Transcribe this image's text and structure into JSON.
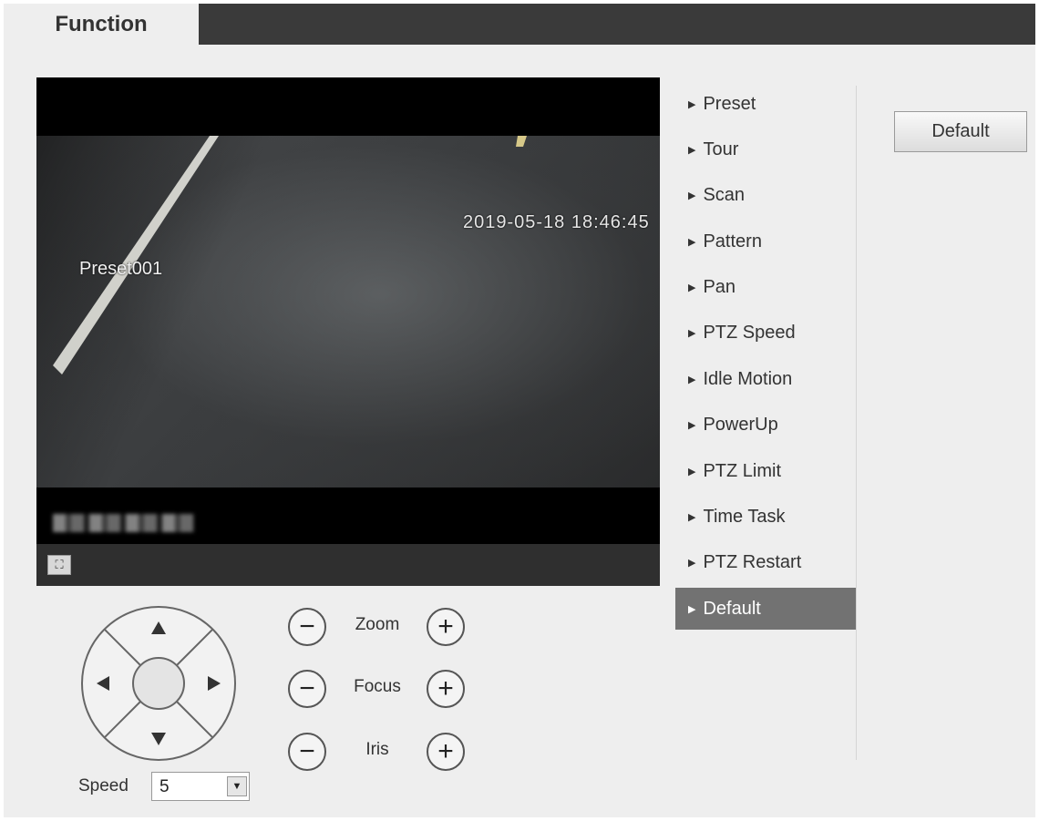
{
  "tab": {
    "label": "Function"
  },
  "video": {
    "timestamp": "2019-05-18 18:46:45",
    "preset_label": "Preset001",
    "fullscreen_icon": "fullscreen-icon"
  },
  "ptz": {
    "zoom_label": "Zoom",
    "focus_label": "Focus",
    "iris_label": "Iris",
    "minus_symbol": "−",
    "plus_symbol": "+",
    "speed_label": "Speed",
    "speed_value": "5"
  },
  "menu": {
    "items": [
      {
        "label": "Preset"
      },
      {
        "label": "Tour"
      },
      {
        "label": "Scan"
      },
      {
        "label": "Pattern"
      },
      {
        "label": "Pan"
      },
      {
        "label": "PTZ Speed"
      },
      {
        "label": "Idle Motion"
      },
      {
        "label": "PowerUp"
      },
      {
        "label": "PTZ Limit"
      },
      {
        "label": "Time Task"
      },
      {
        "label": "PTZ Restart"
      },
      {
        "label": "Default"
      }
    ],
    "active_index": 11
  },
  "actions": {
    "default_label": "Default"
  },
  "colors": {
    "tab_bar": "#3a3a3a",
    "active_menu": "#727272",
    "panel_bg": "#eeeeee"
  }
}
